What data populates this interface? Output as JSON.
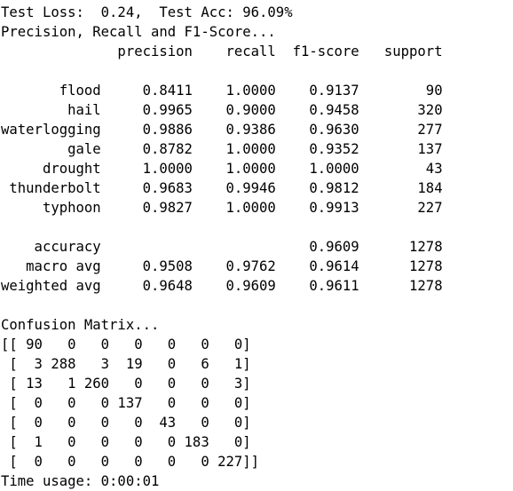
{
  "console": {
    "lines": [
      "Test Loss:  0.24,  Test Acc: 96.09%",
      "Precision, Recall and F1-Score...",
      "              precision    recall  f1-score   support",
      "",
      "       flood     0.8411    1.0000    0.9137        90",
      "        hail     0.9965    0.9000    0.9458       320",
      "waterlogging     0.9886    0.9386    0.9630       277",
      "        gale     0.8782    1.0000    0.9352       137",
      "     drought     1.0000    1.0000    1.0000        43",
      " thunderbolt     0.9683    0.9946    0.9812       184",
      "     typhoon     0.9827    1.0000    0.9913       227",
      "",
      "    accuracy                         0.9609      1278",
      "   macro avg     0.9508    0.9762    0.9614      1278",
      "weighted avg     0.9648    0.9609    0.9611      1278",
      "",
      "Confusion Matrix...",
      "[[ 90   0   0   0   0   0   0]",
      " [  3 288   3  19   0   6   1]",
      " [ 13   1 260   0   0   0   3]",
      " [  0   0   0 137   0   0   0]",
      " [  0   0   0   0  43   0   0]",
      " [  1   0   0   0   0 183   0]",
      " [  0   0   0   0   0   0 227]]",
      "Time usage: 0:00:01"
    ]
  }
}
